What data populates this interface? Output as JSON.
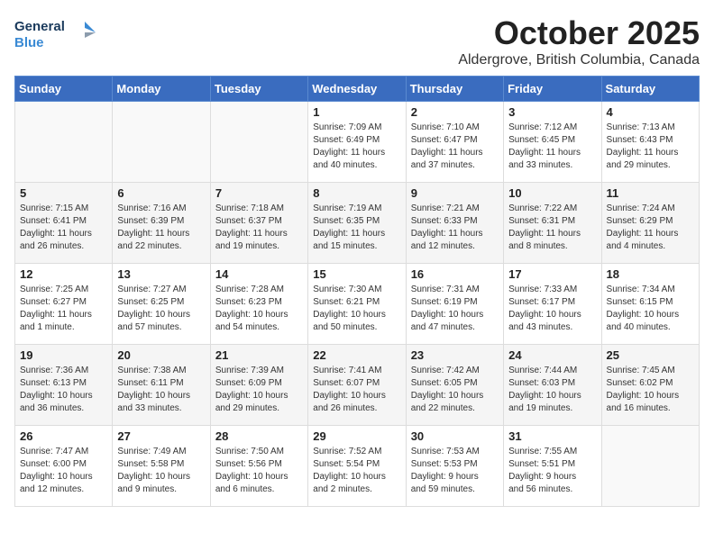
{
  "header": {
    "logo_line1": "General",
    "logo_line2": "Blue",
    "month": "October 2025",
    "location": "Aldergrove, British Columbia, Canada"
  },
  "weekdays": [
    "Sunday",
    "Monday",
    "Tuesday",
    "Wednesday",
    "Thursday",
    "Friday",
    "Saturday"
  ],
  "weeks": [
    [
      {
        "day": "",
        "text": ""
      },
      {
        "day": "",
        "text": ""
      },
      {
        "day": "",
        "text": ""
      },
      {
        "day": "1",
        "text": "Sunrise: 7:09 AM\nSunset: 6:49 PM\nDaylight: 11 hours\nand 40 minutes."
      },
      {
        "day": "2",
        "text": "Sunrise: 7:10 AM\nSunset: 6:47 PM\nDaylight: 11 hours\nand 37 minutes."
      },
      {
        "day": "3",
        "text": "Sunrise: 7:12 AM\nSunset: 6:45 PM\nDaylight: 11 hours\nand 33 minutes."
      },
      {
        "day": "4",
        "text": "Sunrise: 7:13 AM\nSunset: 6:43 PM\nDaylight: 11 hours\nand 29 minutes."
      }
    ],
    [
      {
        "day": "5",
        "text": "Sunrise: 7:15 AM\nSunset: 6:41 PM\nDaylight: 11 hours\nand 26 minutes."
      },
      {
        "day": "6",
        "text": "Sunrise: 7:16 AM\nSunset: 6:39 PM\nDaylight: 11 hours\nand 22 minutes."
      },
      {
        "day": "7",
        "text": "Sunrise: 7:18 AM\nSunset: 6:37 PM\nDaylight: 11 hours\nand 19 minutes."
      },
      {
        "day": "8",
        "text": "Sunrise: 7:19 AM\nSunset: 6:35 PM\nDaylight: 11 hours\nand 15 minutes."
      },
      {
        "day": "9",
        "text": "Sunrise: 7:21 AM\nSunset: 6:33 PM\nDaylight: 11 hours\nand 12 minutes."
      },
      {
        "day": "10",
        "text": "Sunrise: 7:22 AM\nSunset: 6:31 PM\nDaylight: 11 hours\nand 8 minutes."
      },
      {
        "day": "11",
        "text": "Sunrise: 7:24 AM\nSunset: 6:29 PM\nDaylight: 11 hours\nand 4 minutes."
      }
    ],
    [
      {
        "day": "12",
        "text": "Sunrise: 7:25 AM\nSunset: 6:27 PM\nDaylight: 11 hours\nand 1 minute."
      },
      {
        "day": "13",
        "text": "Sunrise: 7:27 AM\nSunset: 6:25 PM\nDaylight: 10 hours\nand 57 minutes."
      },
      {
        "day": "14",
        "text": "Sunrise: 7:28 AM\nSunset: 6:23 PM\nDaylight: 10 hours\nand 54 minutes."
      },
      {
        "day": "15",
        "text": "Sunrise: 7:30 AM\nSunset: 6:21 PM\nDaylight: 10 hours\nand 50 minutes."
      },
      {
        "day": "16",
        "text": "Sunrise: 7:31 AM\nSunset: 6:19 PM\nDaylight: 10 hours\nand 47 minutes."
      },
      {
        "day": "17",
        "text": "Sunrise: 7:33 AM\nSunset: 6:17 PM\nDaylight: 10 hours\nand 43 minutes."
      },
      {
        "day": "18",
        "text": "Sunrise: 7:34 AM\nSunset: 6:15 PM\nDaylight: 10 hours\nand 40 minutes."
      }
    ],
    [
      {
        "day": "19",
        "text": "Sunrise: 7:36 AM\nSunset: 6:13 PM\nDaylight: 10 hours\nand 36 minutes."
      },
      {
        "day": "20",
        "text": "Sunrise: 7:38 AM\nSunset: 6:11 PM\nDaylight: 10 hours\nand 33 minutes."
      },
      {
        "day": "21",
        "text": "Sunrise: 7:39 AM\nSunset: 6:09 PM\nDaylight: 10 hours\nand 29 minutes."
      },
      {
        "day": "22",
        "text": "Sunrise: 7:41 AM\nSunset: 6:07 PM\nDaylight: 10 hours\nand 26 minutes."
      },
      {
        "day": "23",
        "text": "Sunrise: 7:42 AM\nSunset: 6:05 PM\nDaylight: 10 hours\nand 22 minutes."
      },
      {
        "day": "24",
        "text": "Sunrise: 7:44 AM\nSunset: 6:03 PM\nDaylight: 10 hours\nand 19 minutes."
      },
      {
        "day": "25",
        "text": "Sunrise: 7:45 AM\nSunset: 6:02 PM\nDaylight: 10 hours\nand 16 minutes."
      }
    ],
    [
      {
        "day": "26",
        "text": "Sunrise: 7:47 AM\nSunset: 6:00 PM\nDaylight: 10 hours\nand 12 minutes."
      },
      {
        "day": "27",
        "text": "Sunrise: 7:49 AM\nSunset: 5:58 PM\nDaylight: 10 hours\nand 9 minutes."
      },
      {
        "day": "28",
        "text": "Sunrise: 7:50 AM\nSunset: 5:56 PM\nDaylight: 10 hours\nand 6 minutes."
      },
      {
        "day": "29",
        "text": "Sunrise: 7:52 AM\nSunset: 5:54 PM\nDaylight: 10 hours\nand 2 minutes."
      },
      {
        "day": "30",
        "text": "Sunrise: 7:53 AM\nSunset: 5:53 PM\nDaylight: 9 hours\nand 59 minutes."
      },
      {
        "day": "31",
        "text": "Sunrise: 7:55 AM\nSunset: 5:51 PM\nDaylight: 9 hours\nand 56 minutes."
      },
      {
        "day": "",
        "text": ""
      }
    ]
  ]
}
